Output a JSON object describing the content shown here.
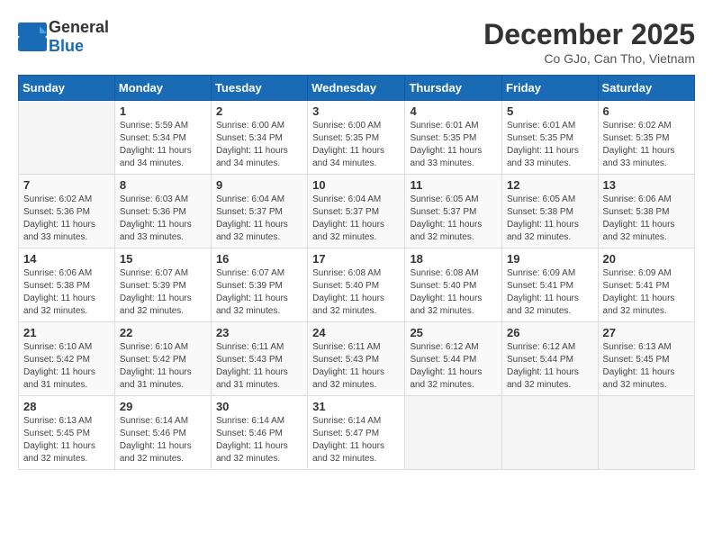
{
  "header": {
    "logo_general": "General",
    "logo_blue": "Blue",
    "month": "December 2025",
    "location": "Co GJo, Can Tho, Vietnam"
  },
  "weekdays": [
    "Sunday",
    "Monday",
    "Tuesday",
    "Wednesday",
    "Thursday",
    "Friday",
    "Saturday"
  ],
  "weeks": [
    [
      {
        "day": "",
        "sunrise": "",
        "sunset": "",
        "daylight": ""
      },
      {
        "day": "1",
        "sunrise": "Sunrise: 5:59 AM",
        "sunset": "Sunset: 5:34 PM",
        "daylight": "Daylight: 11 hours and 34 minutes."
      },
      {
        "day": "2",
        "sunrise": "Sunrise: 6:00 AM",
        "sunset": "Sunset: 5:34 PM",
        "daylight": "Daylight: 11 hours and 34 minutes."
      },
      {
        "day": "3",
        "sunrise": "Sunrise: 6:00 AM",
        "sunset": "Sunset: 5:35 PM",
        "daylight": "Daylight: 11 hours and 34 minutes."
      },
      {
        "day": "4",
        "sunrise": "Sunrise: 6:01 AM",
        "sunset": "Sunset: 5:35 PM",
        "daylight": "Daylight: 11 hours and 33 minutes."
      },
      {
        "day": "5",
        "sunrise": "Sunrise: 6:01 AM",
        "sunset": "Sunset: 5:35 PM",
        "daylight": "Daylight: 11 hours and 33 minutes."
      },
      {
        "day": "6",
        "sunrise": "Sunrise: 6:02 AM",
        "sunset": "Sunset: 5:35 PM",
        "daylight": "Daylight: 11 hours and 33 minutes."
      }
    ],
    [
      {
        "day": "7",
        "sunrise": "Sunrise: 6:02 AM",
        "sunset": "Sunset: 5:36 PM",
        "daylight": "Daylight: 11 hours and 33 minutes."
      },
      {
        "day": "8",
        "sunrise": "Sunrise: 6:03 AM",
        "sunset": "Sunset: 5:36 PM",
        "daylight": "Daylight: 11 hours and 33 minutes."
      },
      {
        "day": "9",
        "sunrise": "Sunrise: 6:04 AM",
        "sunset": "Sunset: 5:37 PM",
        "daylight": "Daylight: 11 hours and 32 minutes."
      },
      {
        "day": "10",
        "sunrise": "Sunrise: 6:04 AM",
        "sunset": "Sunset: 5:37 PM",
        "daylight": "Daylight: 11 hours and 32 minutes."
      },
      {
        "day": "11",
        "sunrise": "Sunrise: 6:05 AM",
        "sunset": "Sunset: 5:37 PM",
        "daylight": "Daylight: 11 hours and 32 minutes."
      },
      {
        "day": "12",
        "sunrise": "Sunrise: 6:05 AM",
        "sunset": "Sunset: 5:38 PM",
        "daylight": "Daylight: 11 hours and 32 minutes."
      },
      {
        "day": "13",
        "sunrise": "Sunrise: 6:06 AM",
        "sunset": "Sunset: 5:38 PM",
        "daylight": "Daylight: 11 hours and 32 minutes."
      }
    ],
    [
      {
        "day": "14",
        "sunrise": "Sunrise: 6:06 AM",
        "sunset": "Sunset: 5:38 PM",
        "daylight": "Daylight: 11 hours and 32 minutes."
      },
      {
        "day": "15",
        "sunrise": "Sunrise: 6:07 AM",
        "sunset": "Sunset: 5:39 PM",
        "daylight": "Daylight: 11 hours and 32 minutes."
      },
      {
        "day": "16",
        "sunrise": "Sunrise: 6:07 AM",
        "sunset": "Sunset: 5:39 PM",
        "daylight": "Daylight: 11 hours and 32 minutes."
      },
      {
        "day": "17",
        "sunrise": "Sunrise: 6:08 AM",
        "sunset": "Sunset: 5:40 PM",
        "daylight": "Daylight: 11 hours and 32 minutes."
      },
      {
        "day": "18",
        "sunrise": "Sunrise: 6:08 AM",
        "sunset": "Sunset: 5:40 PM",
        "daylight": "Daylight: 11 hours and 32 minutes."
      },
      {
        "day": "19",
        "sunrise": "Sunrise: 6:09 AM",
        "sunset": "Sunset: 5:41 PM",
        "daylight": "Daylight: 11 hours and 32 minutes."
      },
      {
        "day": "20",
        "sunrise": "Sunrise: 6:09 AM",
        "sunset": "Sunset: 5:41 PM",
        "daylight": "Daylight: 11 hours and 32 minutes."
      }
    ],
    [
      {
        "day": "21",
        "sunrise": "Sunrise: 6:10 AM",
        "sunset": "Sunset: 5:42 PM",
        "daylight": "Daylight: 11 hours and 31 minutes."
      },
      {
        "day": "22",
        "sunrise": "Sunrise: 6:10 AM",
        "sunset": "Sunset: 5:42 PM",
        "daylight": "Daylight: 11 hours and 31 minutes."
      },
      {
        "day": "23",
        "sunrise": "Sunrise: 6:11 AM",
        "sunset": "Sunset: 5:43 PM",
        "daylight": "Daylight: 11 hours and 31 minutes."
      },
      {
        "day": "24",
        "sunrise": "Sunrise: 6:11 AM",
        "sunset": "Sunset: 5:43 PM",
        "daylight": "Daylight: 11 hours and 32 minutes."
      },
      {
        "day": "25",
        "sunrise": "Sunrise: 6:12 AM",
        "sunset": "Sunset: 5:44 PM",
        "daylight": "Daylight: 11 hours and 32 minutes."
      },
      {
        "day": "26",
        "sunrise": "Sunrise: 6:12 AM",
        "sunset": "Sunset: 5:44 PM",
        "daylight": "Daylight: 11 hours and 32 minutes."
      },
      {
        "day": "27",
        "sunrise": "Sunrise: 6:13 AM",
        "sunset": "Sunset: 5:45 PM",
        "daylight": "Daylight: 11 hours and 32 minutes."
      }
    ],
    [
      {
        "day": "28",
        "sunrise": "Sunrise: 6:13 AM",
        "sunset": "Sunset: 5:45 PM",
        "daylight": "Daylight: 11 hours and 32 minutes."
      },
      {
        "day": "29",
        "sunrise": "Sunrise: 6:14 AM",
        "sunset": "Sunset: 5:46 PM",
        "daylight": "Daylight: 11 hours and 32 minutes."
      },
      {
        "day": "30",
        "sunrise": "Sunrise: 6:14 AM",
        "sunset": "Sunset: 5:46 PM",
        "daylight": "Daylight: 11 hours and 32 minutes."
      },
      {
        "day": "31",
        "sunrise": "Sunrise: 6:14 AM",
        "sunset": "Sunset: 5:47 PM",
        "daylight": "Daylight: 11 hours and 32 minutes."
      },
      {
        "day": "",
        "sunrise": "",
        "sunset": "",
        "daylight": ""
      },
      {
        "day": "",
        "sunrise": "",
        "sunset": "",
        "daylight": ""
      },
      {
        "day": "",
        "sunrise": "",
        "sunset": "",
        "daylight": ""
      }
    ]
  ]
}
